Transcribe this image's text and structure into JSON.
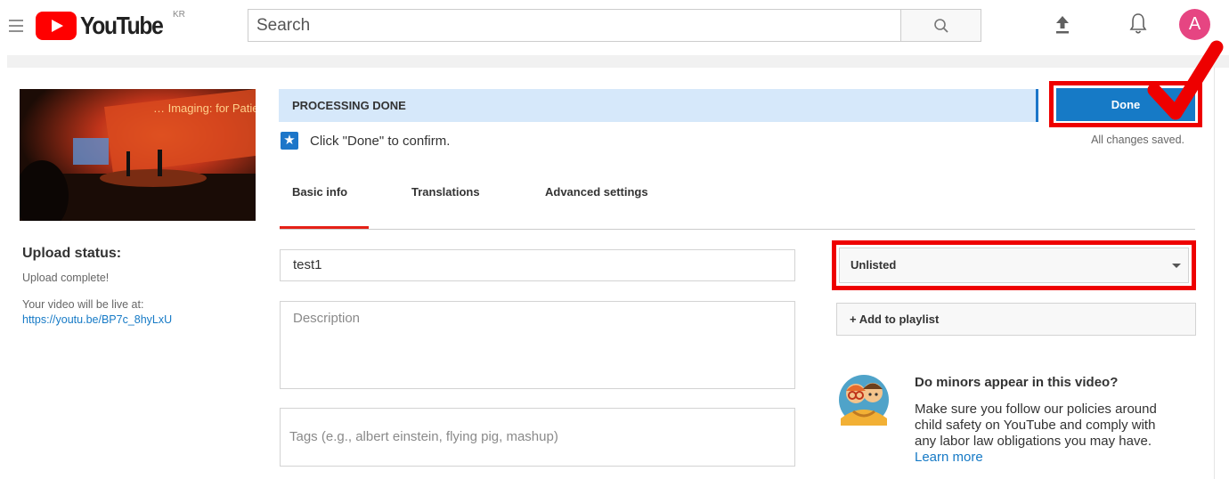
{
  "header": {
    "logo_text": "YouTube",
    "country_code": "KR",
    "search_placeholder": "Search",
    "avatar_initial": "A"
  },
  "sidebar": {
    "upload_status_title": "Upload status:",
    "upload_status_text": "Upload complete!",
    "live_label": "Your video will be live at:",
    "live_link": "https://youtu.be/BP7c_8hyLxU",
    "thumbnail_text": "… Imaging: for Patients"
  },
  "status": {
    "processing_text": "PROCESSING DONE",
    "confirm_text": "Click \"Done\" to confirm.",
    "done_label": "Done",
    "changes_saved": "All changes saved."
  },
  "tabs": [
    {
      "label": "Basic info",
      "active": true
    },
    {
      "label": "Translations",
      "active": false
    },
    {
      "label": "Advanced settings",
      "active": false
    }
  ],
  "form": {
    "title_value": "test1",
    "description_placeholder": "Description",
    "tags_placeholder": "Tags (e.g., albert einstein, flying pig, mashup)",
    "privacy_value": "Unlisted",
    "playlist_label": "+ Add to playlist"
  },
  "minors": {
    "title": "Do minors appear in this video?",
    "text": "Make sure you follow our policies around child safety on YouTube and comply with any labor law obligations you may have.",
    "link_text": "Learn more"
  },
  "colors": {
    "brand_red": "#ff0000",
    "accent_blue": "#167ac6",
    "highlight_red": "#ee0000",
    "processing_bg": "#d6e8fa"
  }
}
